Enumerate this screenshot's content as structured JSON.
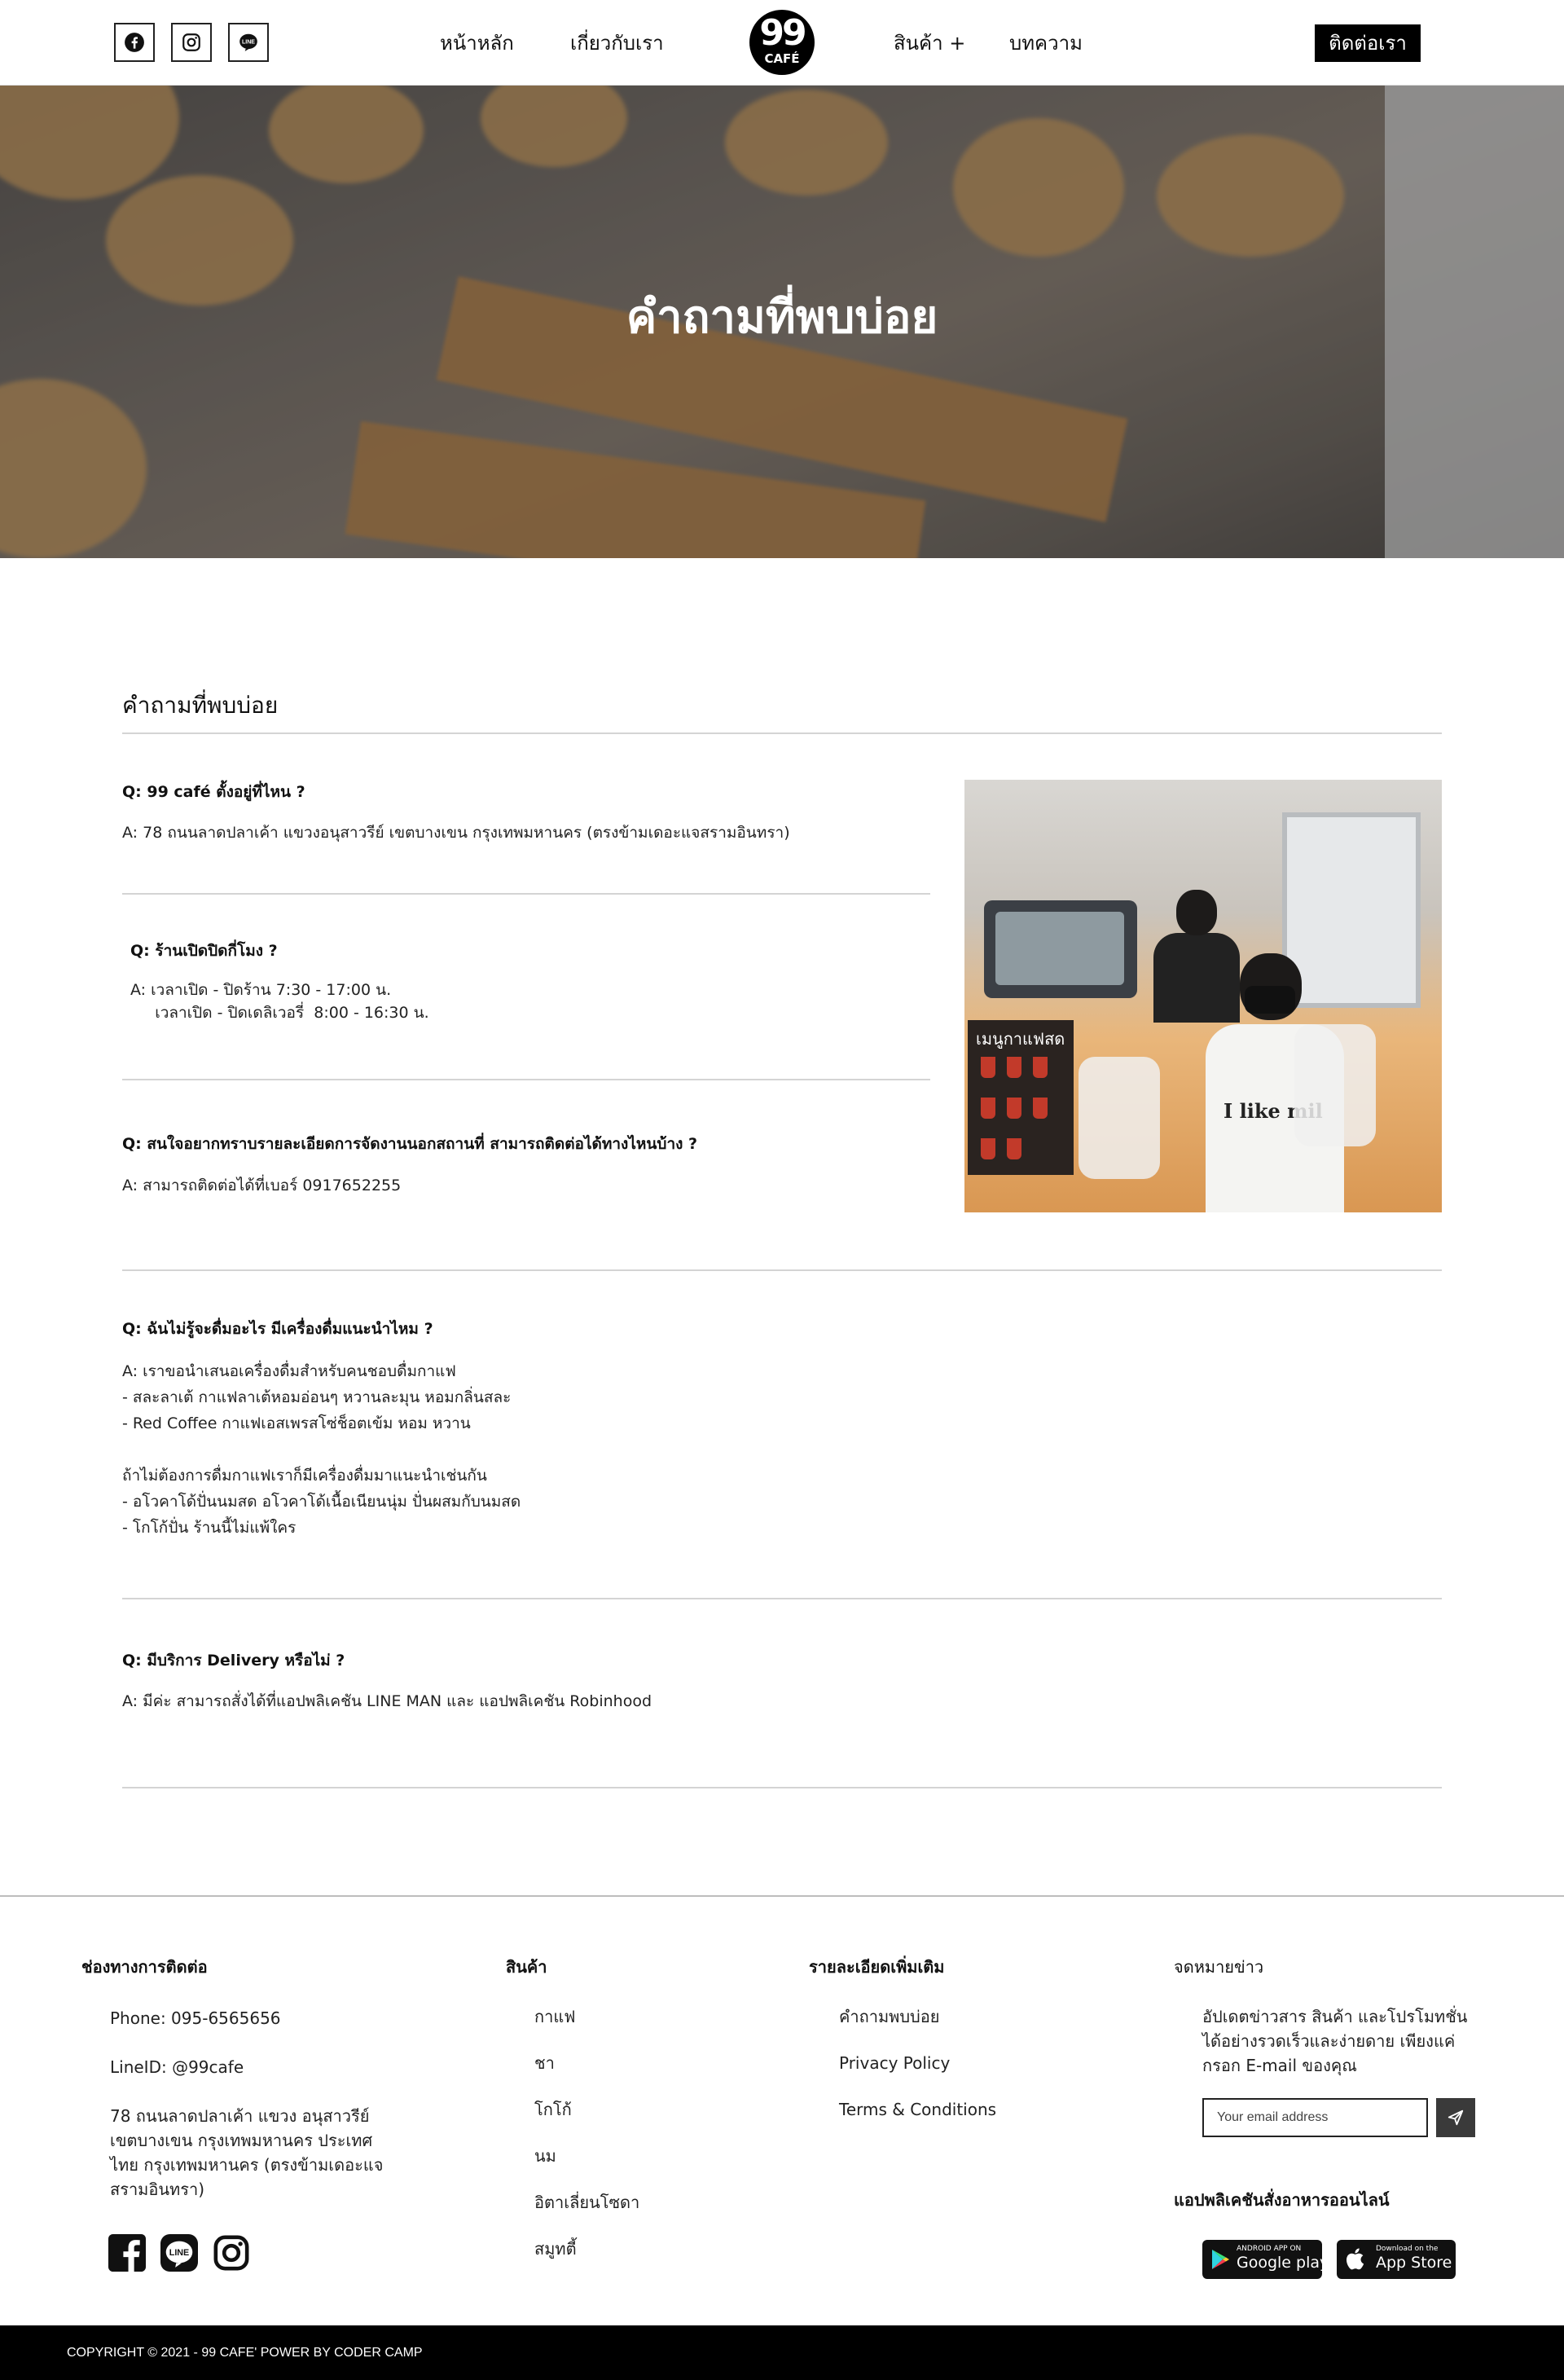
{
  "header": {
    "nav": [
      "หน้าหลัก",
      "เกี่ยวกับเรา",
      "สินค้า +",
      "บทความ"
    ],
    "logo_number": "99",
    "logo_text": "CAFÉ",
    "contact_label": "ติดต่อเรา",
    "social_icons": [
      "facebook-icon",
      "instagram-icon",
      "line-icon"
    ]
  },
  "hero": {
    "title": "คำถามที่พบบ่อย"
  },
  "faq": {
    "section_title": "คำถามที่พบบ่อย",
    "items": [
      {
        "q": "Q: 99 café ตั้งอยู่ที่ไหน ?",
        "a": [
          "A: 78 ถนนลาดปลาเค้า แขวงอนุสาวรีย์ เขตบางเขน กรุงเทพมหานคร (ตรงข้ามเดอะแจสรามอินทรา)"
        ]
      },
      {
        "q": "Q: ร้านเปิดปิดกี่โมง ?",
        "a": [
          "A: เวลาเปิด - ปิดร้าน  7:30 - 17:00 น.",
          "     เวลาเปิด - ปิดเดลิเวอรี่  8:00 - 16:30 น."
        ]
      },
      {
        "q": "Q: สนใจอยากทราบรายละเอียดการจัดงานนอกสถานที่ สามารถติดต่อได้ทางไหนบ้าง ?",
        "a": [
          "A: สามารถติดต่อได้ที่เบอร์ 0917652255"
        ]
      },
      {
        "q": "Q: ฉันไม่รู้จะดื่มอะไร มีเครื่องดื่มแนะนำไหม ?",
        "a": [
          "A: เราขอนำเสนอเครื่องดื่มสำหรับคนชอบดื่มกาแฟ",
          "- สละลาเต้  กาแฟลาเต้หอมอ่อนๆ  หวานละมุน หอมกลิ่นสละ",
          "- Red Coffee กาแฟเอสเพรสโซ่ช็อตเข้ม หอม หวาน",
          "",
          "ถ้าไม่ต้องการดื่มกาแฟเราก็มีเครื่องดื่มมาแนะนำเช่นกัน",
          "- อโวคาโด้ปั่นนมสด อโวคาโด้เนื้อเนียนนุ่ม ปั่นผสมกับนมสด",
          "- โกโก้ปั่น ร้านนี้ไม่แพ้ใคร"
        ]
      },
      {
        "q": "Q: มีบริการ Delivery หรือไม่ ?",
        "a": [
          "A: มีค่ะ สามารถสั่งได้ที่แอปพลิเคชัน LINE MAN และ แอปพลิเคชัน Robinhood"
        ]
      }
    ],
    "photo": {
      "menu_sign": "เมนูกาแฟสด",
      "shirt_text": "I like mil"
    }
  },
  "footer": {
    "contact": {
      "heading": "ช่องทางการติดต่อ",
      "phone": "Phone: 095-6565656",
      "line": "LineID: @99cafe",
      "address": [
        "78 ถนนลาดปลาเค้า แขวง อนุสาวรีย์",
        "เขตบางเขน กรุงเทพมหานคร ประเทศ",
        "ไทย กรุงเทพมหานคร (ตรงข้ามเดอะแจ",
        "สรามอินทรา)"
      ],
      "social_icons": [
        "facebook-icon",
        "line-icon",
        "instagram-icon"
      ]
    },
    "products": {
      "heading": "สินค้า",
      "items": [
        "กาแฟ",
        "ชา",
        "โกโก้",
        "นม",
        "อิตาเลี่ยนโซดา",
        "สมูทตี้"
      ]
    },
    "more": {
      "heading": "รายละเอียดเพิ่มเติม",
      "items": [
        "คำถามพบบ่อย",
        "Privacy Policy",
        "Terms & Conditions"
      ]
    },
    "newsletter": {
      "heading": "จดหมายข่าว",
      "text": [
        "อัปเดตข่าวสาร สินค้า และโปรโมทชั่น",
        "ได้อย่างรวดเร็วและง่ายดาย เพียงแค่",
        "กรอก E-mail ของคุณ"
      ],
      "placeholder": "Your email address"
    },
    "apps": {
      "heading": "แอปพลิเคชันสั่งอาหารออนไลน์",
      "google_small": "ANDROID APP ON",
      "google_big": "Google play",
      "apple_small": "Download on the",
      "apple_big": "App Store"
    },
    "copyright": "COPYRIGHT © 2021 - 99 CAFE' POWER BY CODER CAMP"
  }
}
